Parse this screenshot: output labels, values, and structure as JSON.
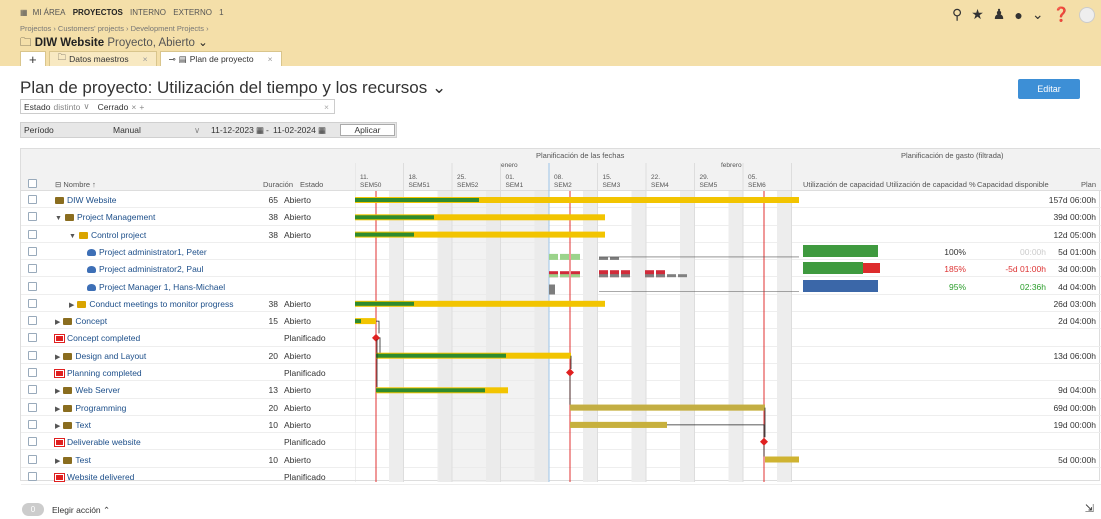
{
  "nav": {
    "items": [
      "MI ÁREA",
      "PROYECTOS",
      "INTERNO",
      "EXTERNO",
      "1"
    ],
    "breadcrumb": "Projectos › Customers' projects › Development Projects ›",
    "project_name": "DIW Website",
    "project_sub": "Proyecto, Abierto"
  },
  "tabs": [
    {
      "label": "+"
    },
    {
      "label": "Datos maestros"
    },
    {
      "label": "Plan de proyecto"
    }
  ],
  "page": {
    "title": "Plan de proyecto: Utilización del tiempo y los recursos",
    "edit_label": "Editar"
  },
  "filter": {
    "field": "Estado",
    "op": "distinto",
    "value": "Cerrado"
  },
  "period": {
    "label": "Período",
    "mode": "Manual",
    "from": "11-12-2023",
    "to": "11-02-2024",
    "apply": "Aplicar"
  },
  "table": {
    "col_name": "Nombre",
    "col_duration": "Duración",
    "col_status": "Estado",
    "gantt_header": "Planificación de las fechas",
    "cost_header": "Planificación de gasto (filtrada)",
    "col_util": "Utilización de capacidad",
    "col_util_pct": "Utilización de capacidad %",
    "col_avail": "Capacidad disponible",
    "col_plan": "Plan",
    "month_jan": "enero",
    "month_feb": "febrero",
    "weeks": [
      {
        "d": "11.",
        "w": "SEM50"
      },
      {
        "d": "18.",
        "w": "SEM51"
      },
      {
        "d": "25.",
        "w": "SEM52"
      },
      {
        "d": "01.",
        "w": "SEM1"
      },
      {
        "d": "08.",
        "w": "SEM2"
      },
      {
        "d": "15.",
        "w": "SEM3"
      },
      {
        "d": "22.",
        "w": "SEM4"
      },
      {
        "d": "29.",
        "w": "SEM5"
      },
      {
        "d": "05.",
        "w": "SEM6"
      }
    ]
  },
  "rows": [
    {
      "name": "DIW Website",
      "dur": "65",
      "status": "Abierto",
      "plan": "157d 06:00h",
      "pct": "",
      "cap": ""
    },
    {
      "name": "Project Management",
      "dur": "38",
      "status": "Abierto",
      "plan": "39d 00:00h",
      "pct": "",
      "cap": ""
    },
    {
      "name": "Control project",
      "dur": "38",
      "status": "Abierto",
      "plan": "12d 05:00h",
      "pct": "",
      "cap": ""
    },
    {
      "name": "Project administrator1, Peter",
      "dur": "",
      "status": "",
      "plan": "5d 01:00h",
      "pct": "100%",
      "cap": "00:00h"
    },
    {
      "name": "Project administrator2, Paul",
      "dur": "",
      "status": "",
      "plan": "3d 00:00h",
      "pct": "185%",
      "cap": "-5d 01:00h"
    },
    {
      "name": "Project Manager 1, Hans-Michael",
      "dur": "",
      "status": "",
      "plan": "4d 04:00h",
      "pct": "95%",
      "cap": "02:36h"
    },
    {
      "name": "Conduct meetings to monitor progress",
      "dur": "38",
      "status": "Abierto",
      "plan": "26d 03:00h",
      "pct": "",
      "cap": ""
    },
    {
      "name": "Concept",
      "dur": "15",
      "status": "Abierto",
      "plan": "2d 04:00h",
      "pct": "",
      "cap": ""
    },
    {
      "name": "Concept completed",
      "dur": "",
      "status": "Planificado",
      "plan": "",
      "pct": "",
      "cap": ""
    },
    {
      "name": "Design and Layout",
      "dur": "20",
      "status": "Abierto",
      "plan": "13d 06:00h",
      "pct": "",
      "cap": ""
    },
    {
      "name": "Planning completed",
      "dur": "",
      "status": "Planificado",
      "plan": "",
      "pct": "",
      "cap": ""
    },
    {
      "name": "Web Server",
      "dur": "13",
      "status": "Abierto",
      "plan": "9d 04:00h",
      "pct": "",
      "cap": ""
    },
    {
      "name": "Programming",
      "dur": "20",
      "status": "Abierto",
      "plan": "69d 00:00h",
      "pct": "",
      "cap": ""
    },
    {
      "name": "Text",
      "dur": "10",
      "status": "Abierto",
      "plan": "19d 00:00h",
      "pct": "",
      "cap": ""
    },
    {
      "name": "Deliverable website",
      "dur": "",
      "status": "Planificado",
      "plan": "",
      "pct": "",
      "cap": ""
    },
    {
      "name": "Test",
      "dur": "10",
      "status": "Abierto",
      "plan": "5d 00:00h",
      "pct": "",
      "cap": ""
    },
    {
      "name": "Website delivered",
      "dur": "",
      "status": "Planificado",
      "plan": "",
      "pct": "",
      "cap": ""
    }
  ],
  "footer": {
    "count": "0",
    "action": "Elegir acción"
  },
  "colors": {
    "accent": "#3d8fd6",
    "bar_yellow": "#f2c400",
    "bar_green": "#2e8b2e",
    "milestone": "#e02020",
    "link": "#1d4f8a"
  }
}
